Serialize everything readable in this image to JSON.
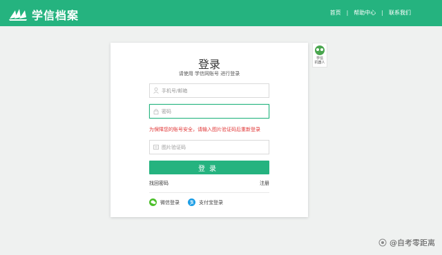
{
  "header": {
    "brand": "学信档案",
    "nav": [
      "首页",
      "帮助中心",
      "联系我们"
    ],
    "separator": "|"
  },
  "login": {
    "title": "登录",
    "subtitle": "请使用 学信网账号 进行登录",
    "phone_placeholder": "手机号/邮箱",
    "password_placeholder": "密码",
    "warning": "为保障您的账号安全，请输入图片验证码后重新登录",
    "captcha_placeholder": "图片验证码",
    "submit_label": "登录",
    "forgot_label": "找回密码",
    "register_label": "注册",
    "wechat_label": "微信登录",
    "alipay_label": "支付宝登录"
  },
  "robot": {
    "label_line1": "学信",
    "label_line2": "机器人"
  },
  "watermark": {
    "text": "@自考零距离"
  },
  "colors": {
    "brand_green": "#25b37f",
    "warning_red": "#e03434",
    "wechat_green": "#4cbf2b",
    "alipay_blue": "#1b9de5"
  }
}
